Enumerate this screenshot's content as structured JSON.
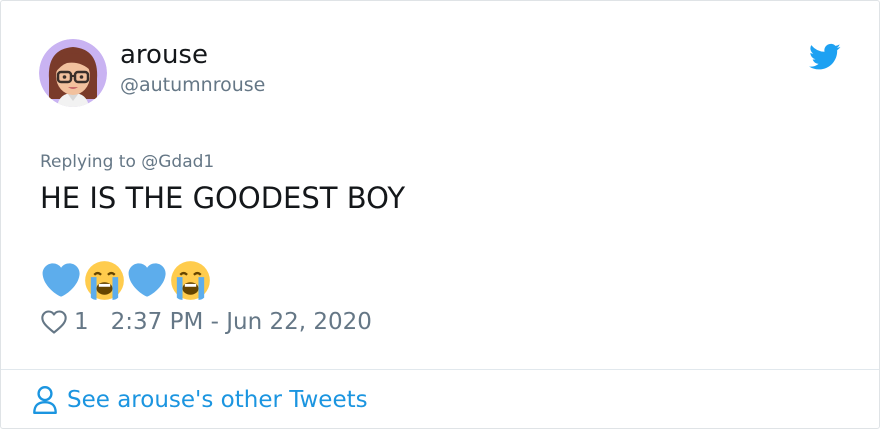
{
  "tweet": {
    "author": {
      "display_name": "arouse",
      "handle": "@autumnrouse"
    },
    "replying_to_prefix": "Replying to",
    "replying_to_handle": "@Gdad1",
    "text": "HE IS THE GOODEST BOY",
    "emojis": [
      "blue-heart-icon",
      "loudly-crying-face-icon",
      "blue-heart-icon",
      "loudly-crying-face-icon"
    ],
    "likes": "1",
    "timestamp": "2:37 PM - Jun 22, 2020"
  },
  "footer": {
    "link_label": "See arouse's other Tweets"
  },
  "colors": {
    "text_primary": "#14171a",
    "text_secondary": "#657786",
    "brand_blue": "#1da1f2",
    "link_blue": "#1b95e0",
    "heart_blue": "#5dadec"
  }
}
